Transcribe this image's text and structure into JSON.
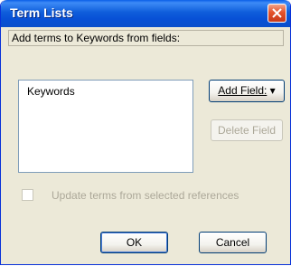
{
  "window": {
    "title": "Term Lists"
  },
  "header": {
    "label": "Add terms to Keywords from fields:"
  },
  "fields_list": {
    "items": [
      "Keywords"
    ]
  },
  "buttons": {
    "add_field": "Add Field:",
    "add_field_arrow": "▾",
    "delete_field": "Delete Field",
    "ok": "OK",
    "cancel": "Cancel"
  },
  "options": {
    "update_terms": {
      "label": "Update terms from selected references",
      "checked": false,
      "enabled": false
    }
  },
  "icons": {
    "close": "close-icon",
    "dropdown": "chevron-down-icon",
    "checkbox": "checkbox-icon"
  }
}
